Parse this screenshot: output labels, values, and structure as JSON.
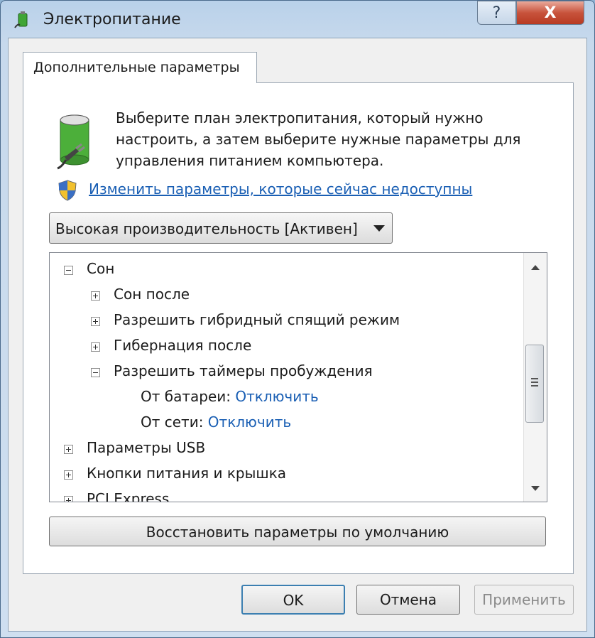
{
  "window": {
    "title": "Электропитание",
    "help_label": "?",
    "close_label": "X"
  },
  "tab": {
    "label": "Дополнительные параметры"
  },
  "intro": {
    "text": "Выберите план электропитания, который нужно настроить, а затем выберите нужные параметры для управления питанием компьютера."
  },
  "admin_link": {
    "label": "Изменить параметры, которые сейчас недоступны"
  },
  "plan_select": {
    "value": "Высокая производительность [Активен]"
  },
  "tree": {
    "items": [
      {
        "label": "Сон",
        "expanded": true
      },
      {
        "label": "Сон после",
        "expanded": false
      },
      {
        "label": "Разрешить гибридный спящий режим",
        "expanded": false
      },
      {
        "label": "Гибернация после",
        "expanded": false
      },
      {
        "label": "Разрешить таймеры пробуждения",
        "expanded": true
      },
      {
        "label": "От батареи:",
        "value": "Отключить"
      },
      {
        "label": "От сети:",
        "value": "Отключить"
      },
      {
        "label": "Параметры USB",
        "expanded": false
      },
      {
        "label": "Кнопки питания и крышка",
        "expanded": false
      },
      {
        "label": "PCI Express",
        "expanded": false
      }
    ]
  },
  "restore_button": {
    "label": "Восстановить параметры по умолчанию"
  },
  "footer": {
    "ok_label": "OK",
    "cancel_label": "Отмена",
    "apply_label": "Применить"
  },
  "colors": {
    "link": "#1a5fb4",
    "titlebar": "#b9d1ea",
    "close": "#c8533c"
  }
}
